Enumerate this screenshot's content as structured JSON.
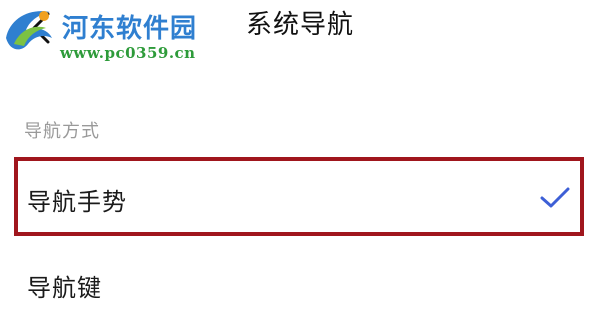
{
  "header": {
    "title": "系统导航"
  },
  "watermark": {
    "name": "河东软件园",
    "url": "www.pc0359.cn"
  },
  "section": {
    "title": "导航方式",
    "options": [
      {
        "label": "导航手势",
        "selected": true
      },
      {
        "label": "导航键",
        "selected": false
      }
    ]
  },
  "colors": {
    "accent": "#3d5fd6",
    "highlight_border": "#a0161d",
    "watermark_blue": "#2f7fd0",
    "watermark_green": "#2e9b3a",
    "section_title": "#9a9a9a"
  }
}
